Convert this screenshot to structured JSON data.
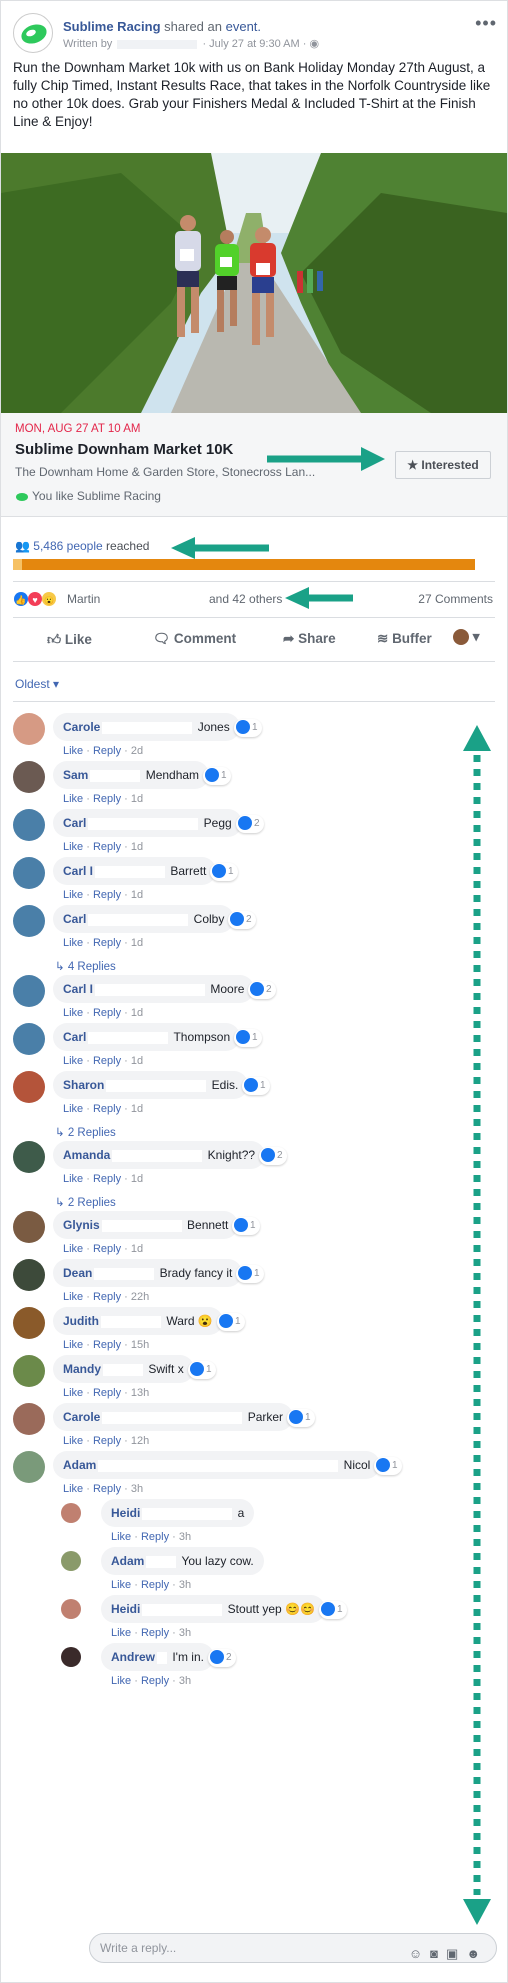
{
  "post": {
    "page_name": "Sublime Racing",
    "shared": "shared an",
    "event_word": "event.",
    "written_by": "Written by",
    "time": "· July 27 at 9:30 AM ·",
    "more": "•••",
    "text": "Run the Downham Market 10k with us on Bank Holiday Monday 27th August, a fully Chip Timed, Instant Results Race, that takes in the Norfolk Countryside like no other 10k does. Grab your Finishers Medal & Included T-Shirt at the Finish Line & Enjoy!"
  },
  "event": {
    "date": "MON, AUG 27 AT 10 AM",
    "title": "Sublime Downham Market 10K",
    "location": "The Downham Home & Garden Store, Stonecross Lan...",
    "you_like": "You like Sublime Racing",
    "interested_label": "★ Interested"
  },
  "reach": {
    "count": "5,486 people",
    "suffix": "reached",
    "fraction": 0.02
  },
  "reactions": {
    "name": "Martin",
    "others": "and 42 others",
    "comments": "27 Comments"
  },
  "actions": {
    "like": "Like",
    "comment": "Comment",
    "share": "Share",
    "buffer": "Buffer"
  },
  "sort": "Oldest ▾",
  "comments": [
    {
      "first": "Carole",
      "last": "Jones",
      "count": "1",
      "time": "2d"
    },
    {
      "first": "Sam",
      "last": "Mendham",
      "count": "1",
      "time": "1d"
    },
    {
      "first": "Carl",
      "last": "Pegg",
      "count": "2",
      "time": "1d"
    },
    {
      "first": "Carl I",
      "last": "Barrett",
      "count": "1",
      "time": "1d"
    },
    {
      "first": "Carl",
      "last": "Colby",
      "count": "2",
      "time": "1d",
      "replies": "4 Replies"
    },
    {
      "first": "Carl I",
      "last": "Moore",
      "count": "2",
      "time": "1d"
    },
    {
      "first": "Carl",
      "last": "Thompson",
      "count": "1",
      "time": "1d"
    },
    {
      "first": "Sharon",
      "last": "Edis.",
      "count": "1",
      "time": "1d",
      "replies": "2 Replies"
    },
    {
      "first": "Amanda",
      "last": "Knight??",
      "count": "2",
      "time": "1d",
      "replies": "2 Replies"
    },
    {
      "first": "Glynis",
      "last": "Bennett",
      "count": "1",
      "time": "1d"
    },
    {
      "first": "Dean",
      "last": "Brady fancy it",
      "count": "1",
      "time": "22h"
    },
    {
      "first": "Judith",
      "last": "Ward 😮",
      "count": "1",
      "time": "15h"
    },
    {
      "first": "Mandy",
      "last": "Swift x",
      "count": "1",
      "time": "13h"
    },
    {
      "first": "Carole",
      "last": "Parker",
      "count": "1",
      "time": "12h"
    },
    {
      "first": "Adam",
      "last": "Nicol",
      "count": "1",
      "time": "3h"
    }
  ],
  "nested": [
    {
      "first": "Heidi",
      "last": "a",
      "count": "",
      "time": "3h"
    },
    {
      "first": "Adam",
      "last": "You lazy cow.",
      "count": "",
      "time": "3h"
    },
    {
      "first": "Heidi",
      "last": "Stoutt yep 😊😊",
      "count": "1",
      "time": "3h"
    },
    {
      "first": "Andrew",
      "last": "I'm in.",
      "count": "2",
      "time": "3h"
    }
  ],
  "labels": {
    "like": "Like",
    "reply": "Reply",
    "dot": "·"
  },
  "write_reply": "Write a reply...",
  "colors": {
    "accent": "#4267b2",
    "annotation": "#1aa187",
    "bar": "#e4870e"
  }
}
